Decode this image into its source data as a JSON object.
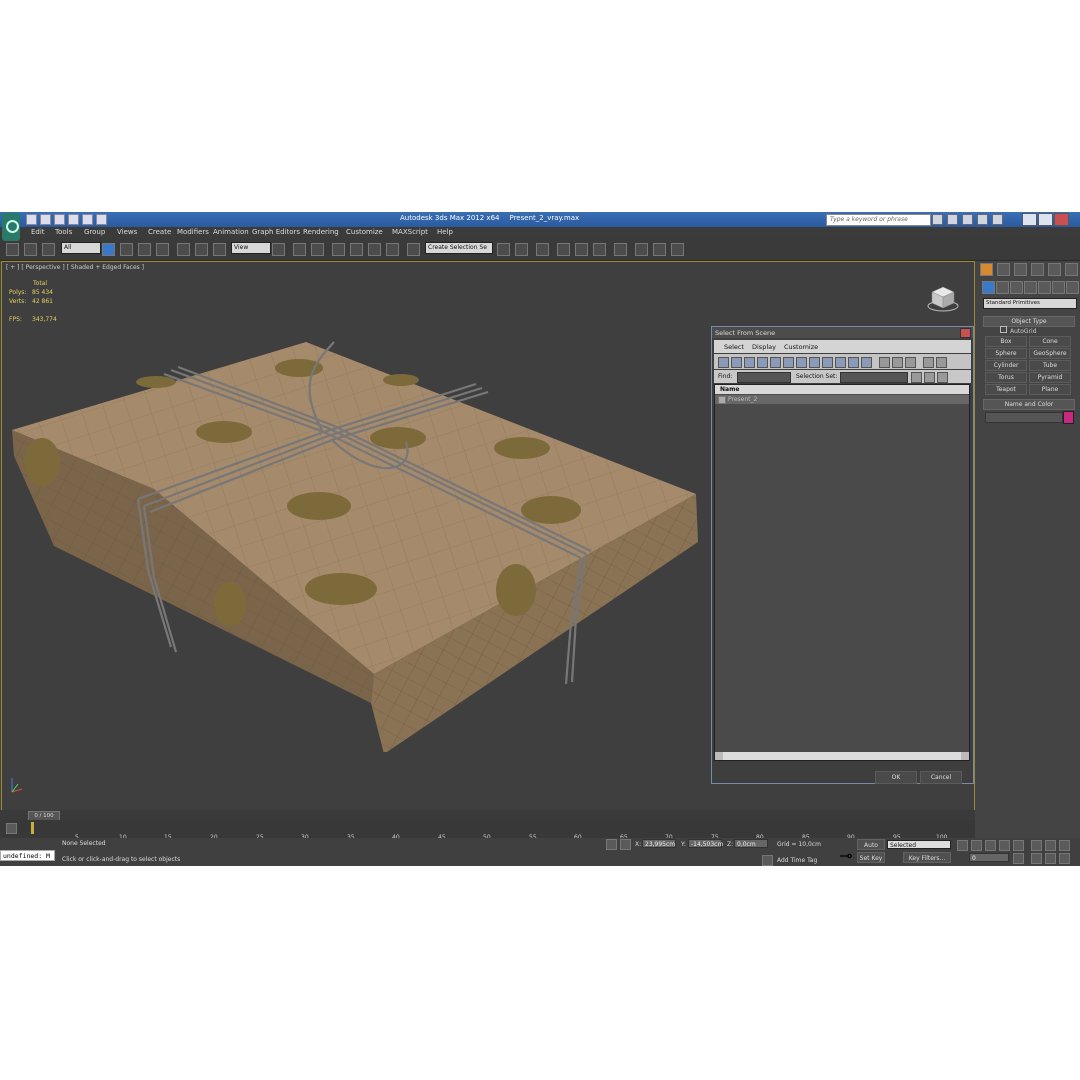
{
  "title": {
    "app": "Autodesk 3ds Max  2012 x64",
    "file": "Present_2_vray.max",
    "search_placeholder": "Type a keyword or phrase"
  },
  "menu": [
    "Edit",
    "Tools",
    "Group",
    "Views",
    "Create",
    "Modifiers",
    "Animation",
    "Graph Editors",
    "Rendering",
    "Customize",
    "MAXScript",
    "Help"
  ],
  "toolbar": {
    "selection_filter": "All",
    "ref_coord": "View",
    "selection_set": "Create Selection Se"
  },
  "viewport": {
    "label": "[ + ] [ Perspective ] [ Shaded + Edged Faces ]",
    "stats": {
      "total_label": "Total",
      "polys_label": "Polys:",
      "polys_value": "85 434",
      "verts_label": "Verts:",
      "verts_value": "42 861",
      "fps_label": "FPS:",
      "fps_value": "343,774"
    }
  },
  "command_panel": {
    "category": "Standard Primitives",
    "object_type_label": "Object Type",
    "autogrid_label": "AutoGrid",
    "primitives": [
      "Box",
      "Cone",
      "Sphere",
      "GeoSphere",
      "Cylinder",
      "Tube",
      "Torus",
      "Pyramid",
      "Teapot",
      "Plane"
    ],
    "name_color_label": "Name and Color",
    "color": "#c8287e"
  },
  "dialog": {
    "title": "Select From Scene",
    "menu": [
      "Select",
      "Display",
      "Customize"
    ],
    "find_label": "Find:",
    "selection_set_label": "Selection Set:",
    "column_name": "Name",
    "items": [
      "Present_2"
    ],
    "ok_label": "OK",
    "cancel_label": "Cancel"
  },
  "timeline": {
    "slider_label": "0 / 100",
    "ticks": [
      "5",
      "10",
      "15",
      "20",
      "25",
      "30",
      "35",
      "40",
      "45",
      "50",
      "55",
      "60",
      "65",
      "70",
      "75",
      "80",
      "85",
      "90",
      "95",
      "100"
    ]
  },
  "status": {
    "maxscript": "undefined: M",
    "selection": "None Selected",
    "prompt": "Click or click-and-drag to select objects",
    "x_label": "X:",
    "x_value": "23,995cm",
    "y_label": "Y:",
    "y_value": "-14,503cm",
    "z_label": "Z:",
    "z_value": "0,0cm",
    "grid": "Grid = 10,0cm",
    "add_time_tag": "Add Time Tag",
    "auto_key": "Auto Key",
    "set_key": "Set Key",
    "key_mode": "Selected",
    "key_filters": "Key Filters...",
    "frame": "0"
  }
}
